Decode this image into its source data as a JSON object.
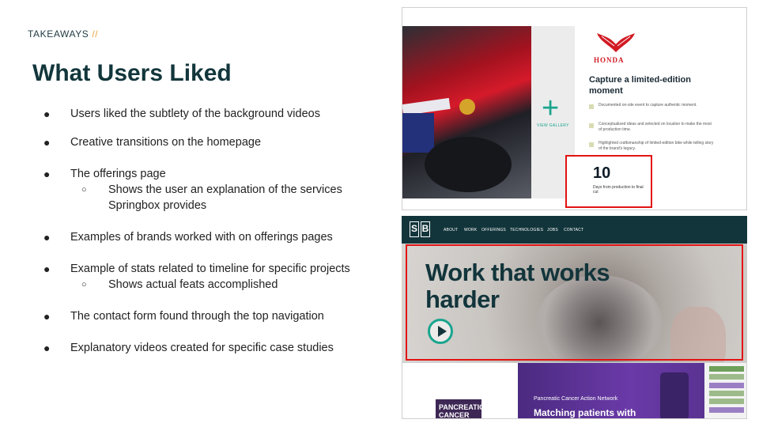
{
  "header": {
    "kicker": "TAKEAWAYS",
    "kicker_slash": "//",
    "title": "What Users Liked"
  },
  "bullets": [
    {
      "text": "Users liked the subtlety of the background videos"
    },
    {
      "text": "Creative transitions on the homepage"
    },
    {
      "text": "The offerings page",
      "sub": [
        "Shows the user an explanation of the services",
        "Springbox provides"
      ]
    },
    {
      "text": "Examples of brands worked with on offerings pages"
    },
    {
      "text": "Example of stats related to timeline for specific projects",
      "sub": [
        "Shows actual feats accomplished"
      ]
    },
    {
      "text": "The contact form found through the top navigation"
    },
    {
      "text": "Explanatory videos created for specific case studies"
    }
  ],
  "panel1": {
    "view_gallery": "VIEW GALLERY",
    "brand": "HONDA",
    "heading": "Capture a limited-edition moment",
    "checklist": [
      "Documented on-site event to capture authentic moment.",
      "Conceptualized ideas and selected on location to make the most of production time.",
      "Highlighted craftsmanship of limited-edition bike while telling story of the brand's legacy."
    ],
    "stat_value": "10",
    "stat_label": "Days from production to final cut"
  },
  "panel2": {
    "logo_letters": [
      "S",
      "B"
    ],
    "nav": [
      "ABOUT",
      "WORK",
      "OFFERINGS",
      "TECHNOLOGIES",
      "JOBS",
      "CONTACT"
    ],
    "headline_line1": "Work that works",
    "headline_line2": "harder"
  },
  "panel3": {
    "logo_text": "PANCREATIC CANCER",
    "org": "Pancreatic Cancer Action Network",
    "title": "Matching patients with"
  },
  "colors": {
    "accent_orange": "#e8a23a",
    "title_teal": "#12363b",
    "highlight_red": "#e21313",
    "brand_green": "#1aa58e"
  }
}
